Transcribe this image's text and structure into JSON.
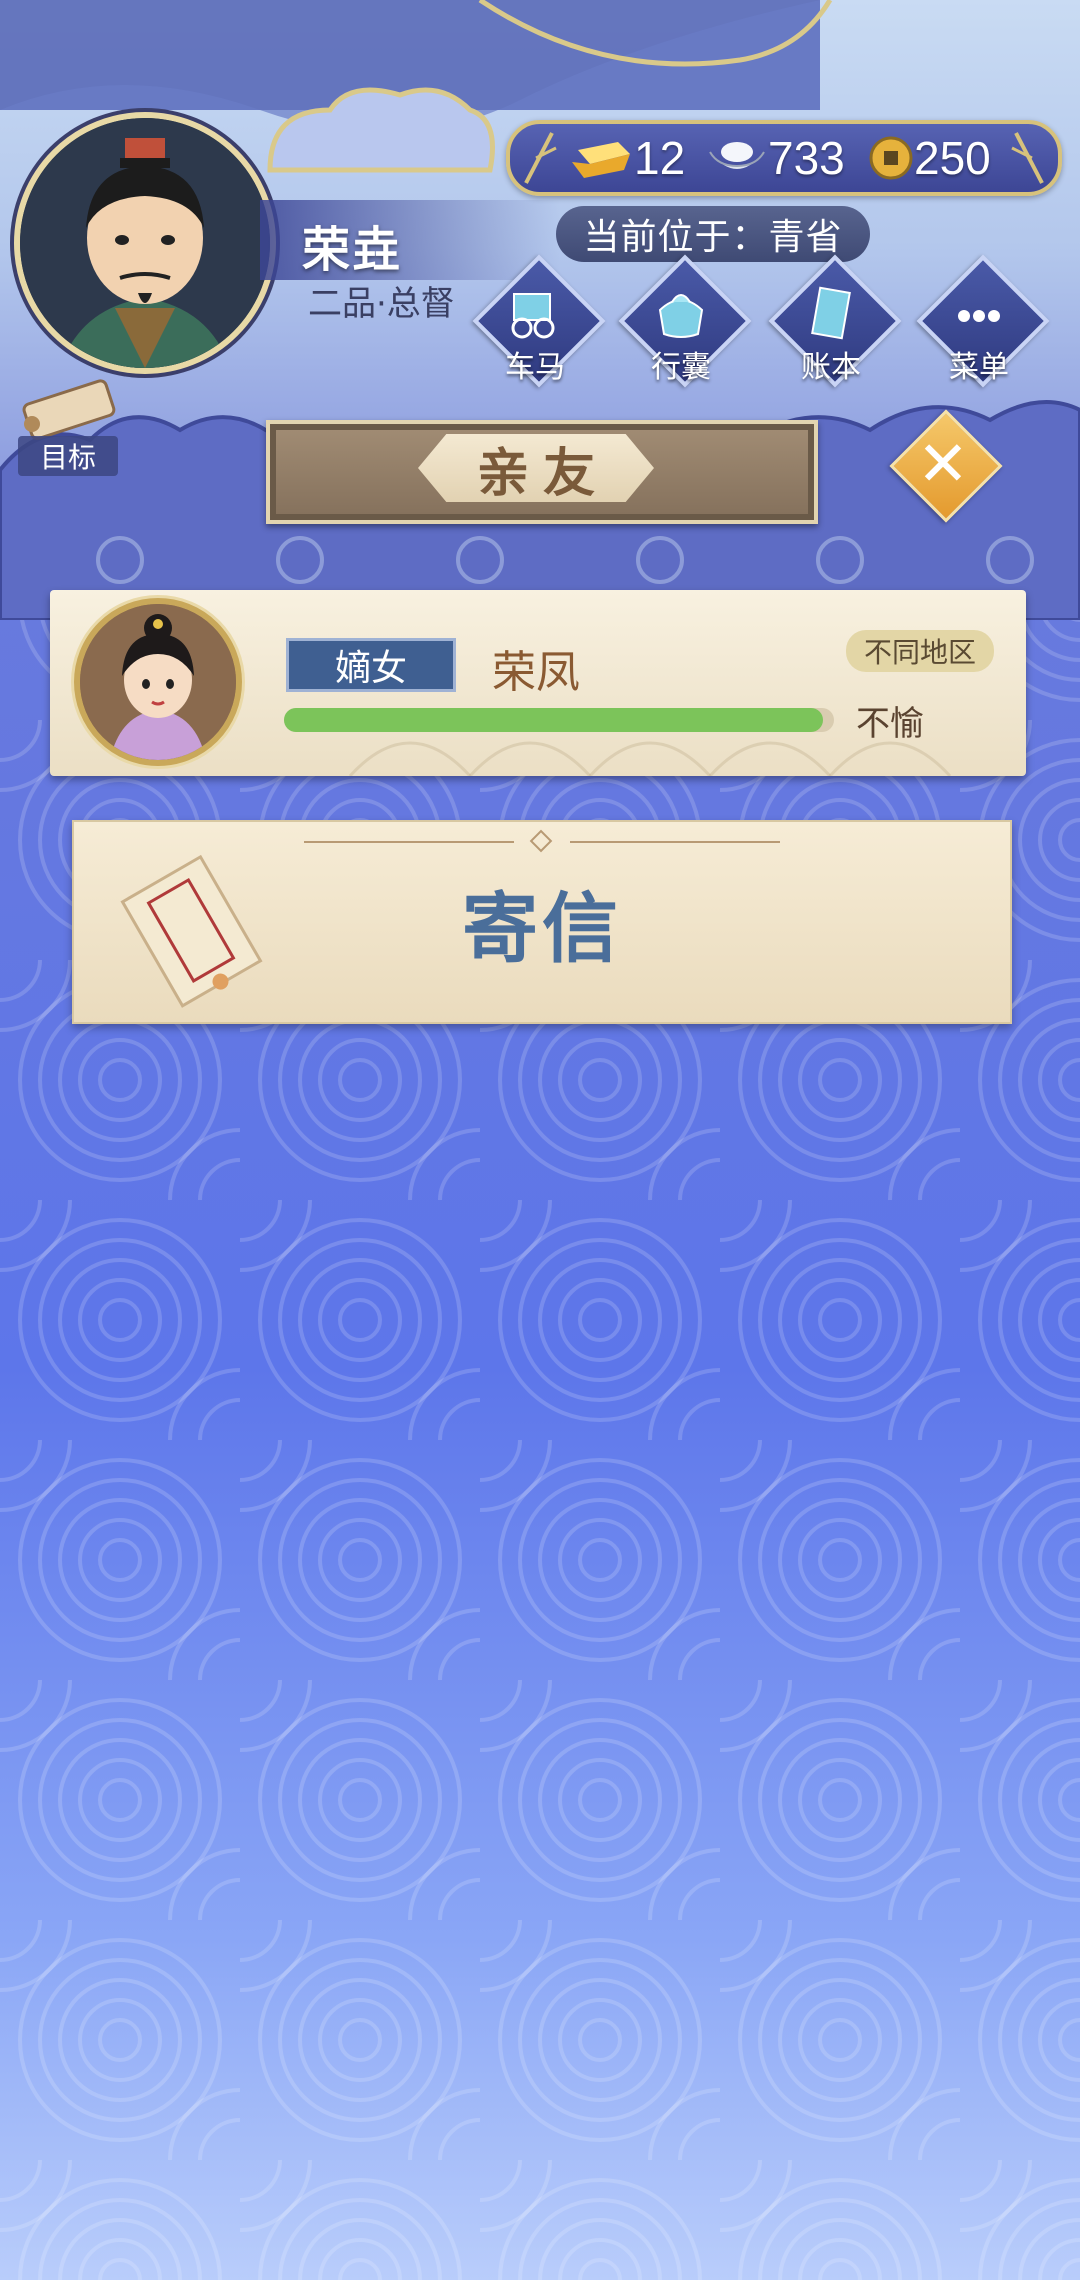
{
  "player": {
    "name": "荣垚",
    "rank": "二品·总督"
  },
  "currency": {
    "gold_bar": "12",
    "silver": "733",
    "coin": "250"
  },
  "location": {
    "text": "当前位于：青省"
  },
  "menu": {
    "items": [
      {
        "label": "车马",
        "icon": "carriage-icon"
      },
      {
        "label": "行囊",
        "icon": "bundle-icon"
      },
      {
        "label": "账本",
        "icon": "ledger-icon"
      },
      {
        "label": "菜单",
        "icon": "more-icon"
      }
    ]
  },
  "goal": {
    "label": "目标"
  },
  "panel": {
    "title": "亲友",
    "close_icon": "close-icon"
  },
  "relative": {
    "relation": "嫡女",
    "name": "荣凤",
    "region": "不同地区",
    "mood": "不愉",
    "affection": 0.98
  },
  "send_letter": {
    "label": "寄信"
  },
  "colors": {
    "accent_gold": "#d7c27c",
    "bar_green": "#7cc45a",
    "title_brown": "#7a5a3a",
    "send_text": "#4a6e9a"
  }
}
